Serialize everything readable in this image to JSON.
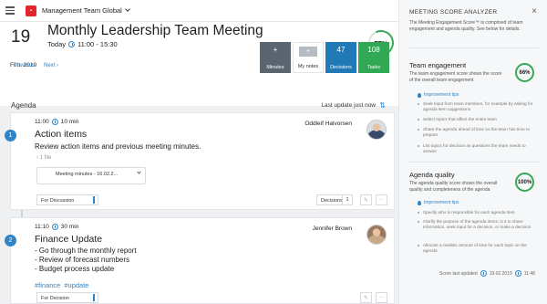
{
  "topbar": {
    "team": "Management Team Global"
  },
  "header": {
    "day": "19",
    "month_year": "Feb, 2019",
    "title": "Monthly Leadership Team Meeting",
    "date_label": "Today",
    "time": "11:00 - 15:30",
    "score": "77%",
    "previous": "Previous",
    "next": "Next"
  },
  "tiles": [
    {
      "value": "+",
      "label": "Minutes"
    },
    {
      "value": "+",
      "label": "My notes"
    },
    {
      "value": "47",
      "label": "Decisions"
    },
    {
      "value": "108",
      "label": "Tasks"
    }
  ],
  "agenda": {
    "label": "Agenda",
    "last_update": "Last update just now"
  },
  "items": [
    {
      "num": "1",
      "time": "11:00",
      "duration": "10 min",
      "title": "Action items",
      "owner": "Oddleif Halvorsen",
      "desc": "Review action items and previous meeting minutes.",
      "files": "1 file",
      "file_name": "Meeting minutes - 16.02.2...",
      "type": "For Discussion",
      "decisions_label": "Decisions",
      "decisions_count": "1"
    },
    {
      "num": "2",
      "time": "11:10",
      "duration": "30 min",
      "title": "Finance Update",
      "owner": "Jennifer Brown",
      "lines": [
        "- Go through the monthly report",
        "- Review of forecast numbers",
        "- Budget process update"
      ],
      "tags": [
        "#finance",
        "#update"
      ],
      "type": "For Decision"
    }
  ],
  "panel": {
    "title": "MEETING SCORE ANALYZER",
    "intro": "The Meeting Engagement Score™ is comprised of team engagement and agenda quality. See below for details.",
    "engagement": {
      "heading": "Team engagement",
      "text": "The team engagement score shows the score of the overall team engagement",
      "score": "66%",
      "tips_label": "Improvement tips",
      "tips": [
        "Seek input from team members, for example by asking for agenda item suggestions",
        "Select topics that affect the entire team",
        "Share the agenda ahead of time so the team has time to prepare",
        "List topics for decision as questions the team needs to answer"
      ]
    },
    "quality": {
      "heading": "Agenda quality",
      "text": "The agenda quality score shows the overall quality and completeness of the agenda",
      "score": "100%",
      "tips_label": "Improvement tips",
      "tips": [
        "Specify who is responsible for each agenda item",
        "Clarify the purpose of the agenda items: is it to share information, seek input for a decision, or make a decision",
        "Allocate a realistic amount of time for each topic on the agenda"
      ]
    },
    "footer_label": "Score last updated",
    "footer_date": "19.02.2019",
    "footer_time": "11:48"
  }
}
